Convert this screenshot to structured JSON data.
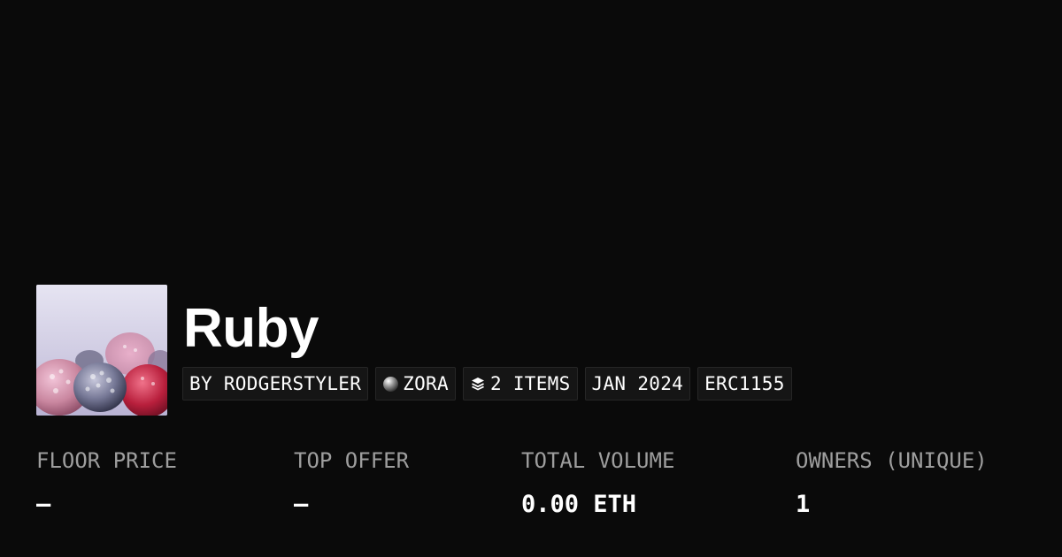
{
  "collection": {
    "name": "Ruby",
    "image_alt": "frozen berries",
    "tags": {
      "creator": "BY RODGERSTYLER",
      "chain": "ZORA",
      "chain_icon": "zora-orb-icon",
      "items": "2 ITEMS",
      "items_icon": "layers-icon",
      "date": "JAN 2024",
      "standard": "ERC1155"
    }
  },
  "stats": {
    "floor_price": {
      "label": "FLOOR PRICE",
      "value": "–"
    },
    "top_offer": {
      "label": "TOP OFFER",
      "value": "–"
    },
    "total_volume": {
      "label": "TOTAL VOLUME",
      "value": "0.00 ETH"
    },
    "owners": {
      "label": "OWNERS (UNIQUE)",
      "value": "1"
    }
  },
  "colors": {
    "background": "#0a0a0a",
    "tag_background": "#151515",
    "tag_border": "#262626",
    "label_gray": "#9e9e9e",
    "text": "#ffffff"
  }
}
